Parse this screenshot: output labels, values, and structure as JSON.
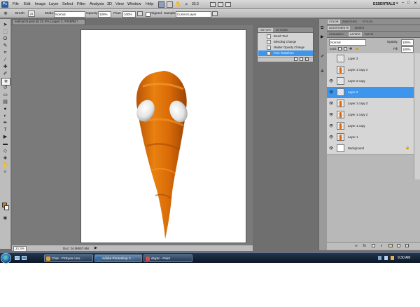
{
  "menubar": {
    "logo": "Ps",
    "items": [
      "File",
      "Edit",
      "Image",
      "Layer",
      "Select",
      "Filter",
      "Analysis",
      "3D",
      "View",
      "Window",
      "Help"
    ],
    "zoom": "33.3",
    "workspace": "ESSENTIALS"
  },
  "options": {
    "brush_label": "Brush:",
    "brush_size": "24",
    "mode_label": "Mode:",
    "mode_value": "Normal",
    "opacity_label": "Opacity:",
    "opacity_value": "100%",
    "flow_label": "Flow:",
    "flow_value": "100%",
    "aligned_label": "Aligned",
    "sample_label": "Sample:",
    "sample_value": "Current Layer"
  },
  "document": {
    "tab_title": "evilcarrot.psd @ 22.3% (Layer 2, RGB/8) *",
    "zoom_readout": "22.3%",
    "doc_info": "Doc: 24.0M/57.6M"
  },
  "history": {
    "tabs": [
      "HISTORY",
      "ACTIONS"
    ],
    "items": [
      {
        "label": "Brush Tool",
        "selected": false
      },
      {
        "label": "Blending Change",
        "selected": false
      },
      {
        "label": "Master Opacity Change",
        "selected": false
      },
      {
        "label": "Free Transform",
        "selected": true
      }
    ]
  },
  "panels": {
    "top_tabs": [
      "COLOR",
      "SWATCHES",
      "STYLES"
    ],
    "mid_tabs": [
      "ADJUSTMENTS",
      "MASKS"
    ],
    "layer_tabs": [
      "CHANNELS",
      "LAYERS",
      "PATHS"
    ],
    "blend_mode": "Normal",
    "opacity_label": "Opacity:",
    "opacity_value": "100%",
    "lock_label": "Lock:",
    "fill_label": "Fill:",
    "fill_value": "100%"
  },
  "layers": [
    {
      "name": "Layer 3",
      "visible": false,
      "selected": false,
      "thumb": "checker"
    },
    {
      "name": "Layer 1 copy 4",
      "visible": false,
      "selected": false,
      "thumb": "figure"
    },
    {
      "name": "Layer 2 copy",
      "visible": true,
      "selected": false,
      "thumb": "checker"
    },
    {
      "name": "Layer 2",
      "visible": true,
      "selected": true,
      "thumb": "checker"
    },
    {
      "name": "Layer 1 copy 3",
      "visible": true,
      "selected": false,
      "thumb": "figure"
    },
    {
      "name": "Layer 1 copy 2",
      "visible": true,
      "selected": false,
      "thumb": "figure"
    },
    {
      "name": "Layer 1 copy",
      "visible": true,
      "selected": false,
      "thumb": "figure"
    },
    {
      "name": "Layer 1",
      "visible": true,
      "selected": false,
      "thumb": "figure"
    },
    {
      "name": "Background",
      "visible": true,
      "selected": false,
      "thumb": "white"
    }
  ],
  "taskbar": {
    "buttons": [
      {
        "label": "Chat - PXEyes.com...",
        "active": false,
        "icon_color": "#e8a030"
      },
      {
        "label": "Adobe Photoshop C...",
        "active": true,
        "icon_color": "#2a6fb5"
      },
      {
        "label": "dsg3c - Paint",
        "active": false,
        "icon_color": "#d94c4c"
      }
    ],
    "clock": "9:30 AM"
  },
  "colors": {
    "carrot": "#df6f0b",
    "selection": "#3d95ec",
    "foreground": "#e07a10"
  }
}
